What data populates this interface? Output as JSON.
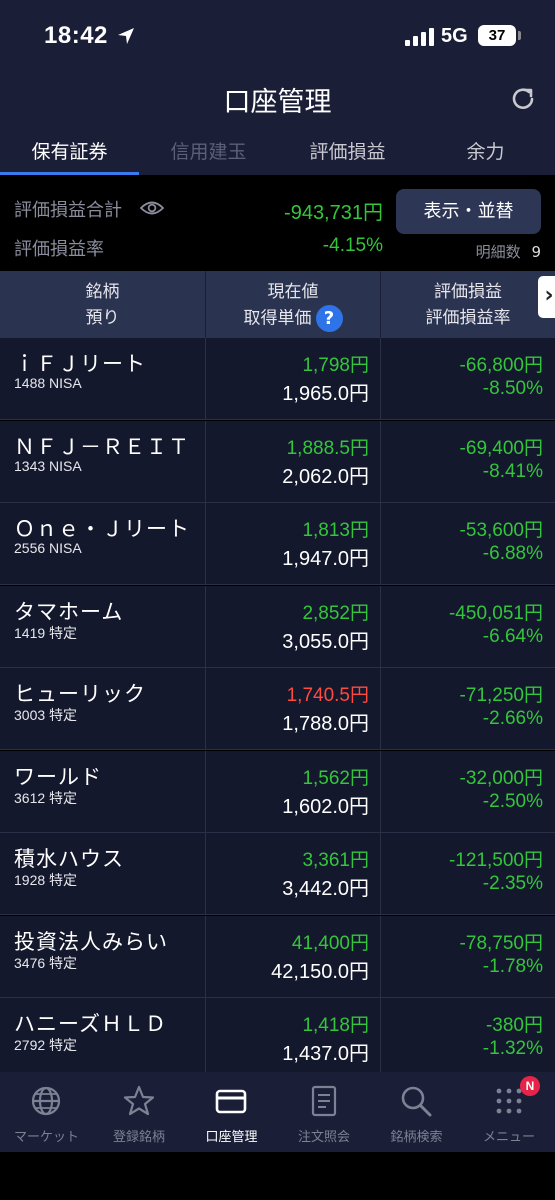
{
  "status_bar": {
    "time": "18:42",
    "network": "5G",
    "battery": "37"
  },
  "header": {
    "title": "口座管理"
  },
  "tabs": [
    {
      "label": "保有証券"
    },
    {
      "label": "信用建玉"
    },
    {
      "label": "評価損益"
    },
    {
      "label": "余力"
    }
  ],
  "summary": {
    "total_label": "評価損益合計",
    "total_value": "-943,731円",
    "rate_label": "評価損益率",
    "rate_value": "-4.15%",
    "sort_button": "表示・並替",
    "detail_label": "明細数",
    "detail_count": "9"
  },
  "table_header": {
    "col1_line1": "銘柄",
    "col1_line2": "預り",
    "col2_line1": "現在値",
    "col2_line2": "取得単価",
    "col3_line1": "評価損益",
    "col3_line2": "評価損益率",
    "help": "?",
    "scroll_arrow": "›"
  },
  "holdings": [
    {
      "name": "ｉＦＪリート",
      "code": "1488 NISA",
      "current": "1,798円",
      "acquired": "1,965.0円",
      "pl": "-66,800円",
      "rate": "-8.50%",
      "current_color": "green"
    },
    {
      "name": "ＮＦＪ－ＲＥＩＴ",
      "code": "1343 NISA",
      "current": "1,888.5円",
      "acquired": "2,062.0円",
      "pl": "-69,400円",
      "rate": "-8.41%",
      "current_color": "green"
    },
    {
      "name": "Ｏｎｅ・Ｊリート",
      "code": "2556 NISA",
      "current": "1,813円",
      "acquired": "1,947.0円",
      "pl": "-53,600円",
      "rate": "-6.88%",
      "current_color": "green"
    },
    {
      "name": "タマホーム",
      "code": "1419 特定",
      "current": "2,852円",
      "acquired": "3,055.0円",
      "pl": "-450,051円",
      "rate": "-6.64%",
      "current_color": "green"
    },
    {
      "name": "ヒューリック",
      "code": "3003 特定",
      "current": "1,740.5円",
      "acquired": "1,788.0円",
      "pl": "-71,250円",
      "rate": "-2.66%",
      "current_color": "red"
    },
    {
      "name": "ワールド",
      "code": "3612 特定",
      "current": "1,562円",
      "acquired": "1,602.0円",
      "pl": "-32,000円",
      "rate": "-2.50%",
      "current_color": "green"
    },
    {
      "name": "積水ハウス",
      "code": "1928 特定",
      "current": "3,361円",
      "acquired": "3,442.0円",
      "pl": "-121,500円",
      "rate": "-2.35%",
      "current_color": "green"
    },
    {
      "name": "投資法人みらい",
      "code": "3476 特定",
      "current": "41,400円",
      "acquired": "42,150.0円",
      "pl": "-78,750円",
      "rate": "-1.78%",
      "current_color": "green"
    },
    {
      "name": "ハニーズＨＬＤ",
      "code": "2792 特定",
      "current": "1,418円",
      "acquired": "1,437.0円",
      "pl": "-380円",
      "rate": "-1.32%",
      "current_color": "green"
    }
  ],
  "bottom_nav": [
    {
      "label": "マーケット",
      "icon": "globe-icon"
    },
    {
      "label": "登録銘柄",
      "icon": "star-icon"
    },
    {
      "label": "口座管理",
      "icon": "card-icon"
    },
    {
      "label": "注文照会",
      "icon": "document-icon"
    },
    {
      "label": "銘柄検索",
      "icon": "search-icon"
    },
    {
      "label": "メニュー",
      "icon": "grid-menu-icon"
    }
  ],
  "menu_badge": "N",
  "colors": {
    "gain_loss_green": "#34c53c",
    "price_up_red": "#ff4a40",
    "accent_blue": "#3a7bf0",
    "header_bg": "#1a1e36"
  }
}
